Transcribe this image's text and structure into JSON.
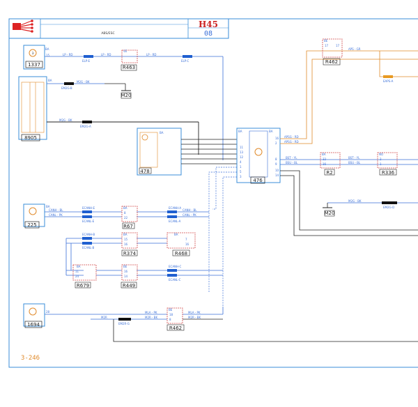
{
  "title_block": {
    "code": "H45",
    "sub_code": "08",
    "label": "ABS/ESC"
  },
  "footer": {
    "page_ref": "3-246"
  },
  "components": [
    {
      "id": "1337",
      "pins_label": "BA",
      "pin": "15"
    },
    {
      "id": "8905",
      "pins_label": "BA"
    },
    {
      "id": "478",
      "pins_label": "BA"
    },
    {
      "id": "476",
      "pins_label": "BA"
    },
    {
      "id": "225",
      "pins_label": "BA"
    },
    {
      "id": "1694",
      "pin": "28"
    }
  ],
  "connectors": [
    {
      "id": "R463",
      "label": "VE"
    },
    {
      "id": "R462",
      "label": "BE"
    },
    {
      "id": "R2",
      "label": "BA"
    },
    {
      "id": "R336",
      "label": "NO"
    },
    {
      "id": "R67",
      "label": "BA"
    },
    {
      "id": "R374",
      "label": "BA"
    },
    {
      "id": "R468",
      "label": "BA"
    },
    {
      "id": "R679",
      "label": "BA"
    },
    {
      "id": "R449",
      "label": "BE"
    }
  ],
  "grounds": [
    "M20",
    "M20",
    "M20"
  ],
  "wire_labels": {
    "lp_rd": "LP - RD",
    "elp_e": "ELP-E",
    "elp_c": "ELP-C",
    "m2g_bk": "M2G - BK",
    "em2g_b": "EM2G-B",
    "em2g_a": "EM2G-A",
    "em2g_d": "EM2G-D",
    "em2r_g": "EM2R-G",
    "aps_gr": "APS - GR",
    "eaps_a": "EAPS-A",
    "apsg_rd": "APSG - RD",
    "bst_yl": "BST - YL",
    "bsu_bl": "BSU - BL",
    "canh_bl": "CANH - BL",
    "canl_pk": "CANL - PK",
    "ecanh_e": "ECANH-E",
    "ecanl_e": "ECANL-E",
    "ecanh_a": "ECANH-A",
    "ecanl_a": "ECANL-A",
    "ecanh_b": "ECANH-B",
    "ecanl_b": "ECANL-B",
    "ecanh_c": "ECANH-C",
    "ecanl_c": "ECANL-C",
    "m2r": "M2R",
    "mla_pk": "MLA - PK",
    "m2r_bk": "M2R - BK"
  },
  "pin_numbers": {
    "p476_left": [
      "11",
      "13",
      "12",
      "4",
      "1",
      "5",
      "3"
    ],
    "p476_right": [
      "16",
      "2",
      "8",
      "9",
      "10",
      "14"
    ],
    "p478": [
      "4",
      "2",
      "3",
      "1",
      "5",
      "6"
    ],
    "r462_top": [
      "17",
      "17"
    ],
    "r462_bot": [
      "18",
      "8"
    ],
    "r2": [
      "32",
      "16"
    ],
    "r336": [
      "2",
      "1"
    ],
    "r67": [
      "8",
      "22"
    ],
    "r374": [
      "15",
      "16"
    ],
    "r468": [
      "7",
      "16"
    ],
    "r679": [
      "11",
      "24"
    ],
    "r449": [
      "16",
      "14"
    ]
  },
  "colors": {
    "wire_blue": "#3a6fd8",
    "wire_orange": "#e08a2a",
    "wire_black": "#222222",
    "frame": "#3a8ed8",
    "connector_red": "#d14a4a",
    "splice_blue": "#1f5fd0",
    "splice_black": "#111111",
    "splice_orange": "#e89a22",
    "logo_red": "#dd2222"
  }
}
